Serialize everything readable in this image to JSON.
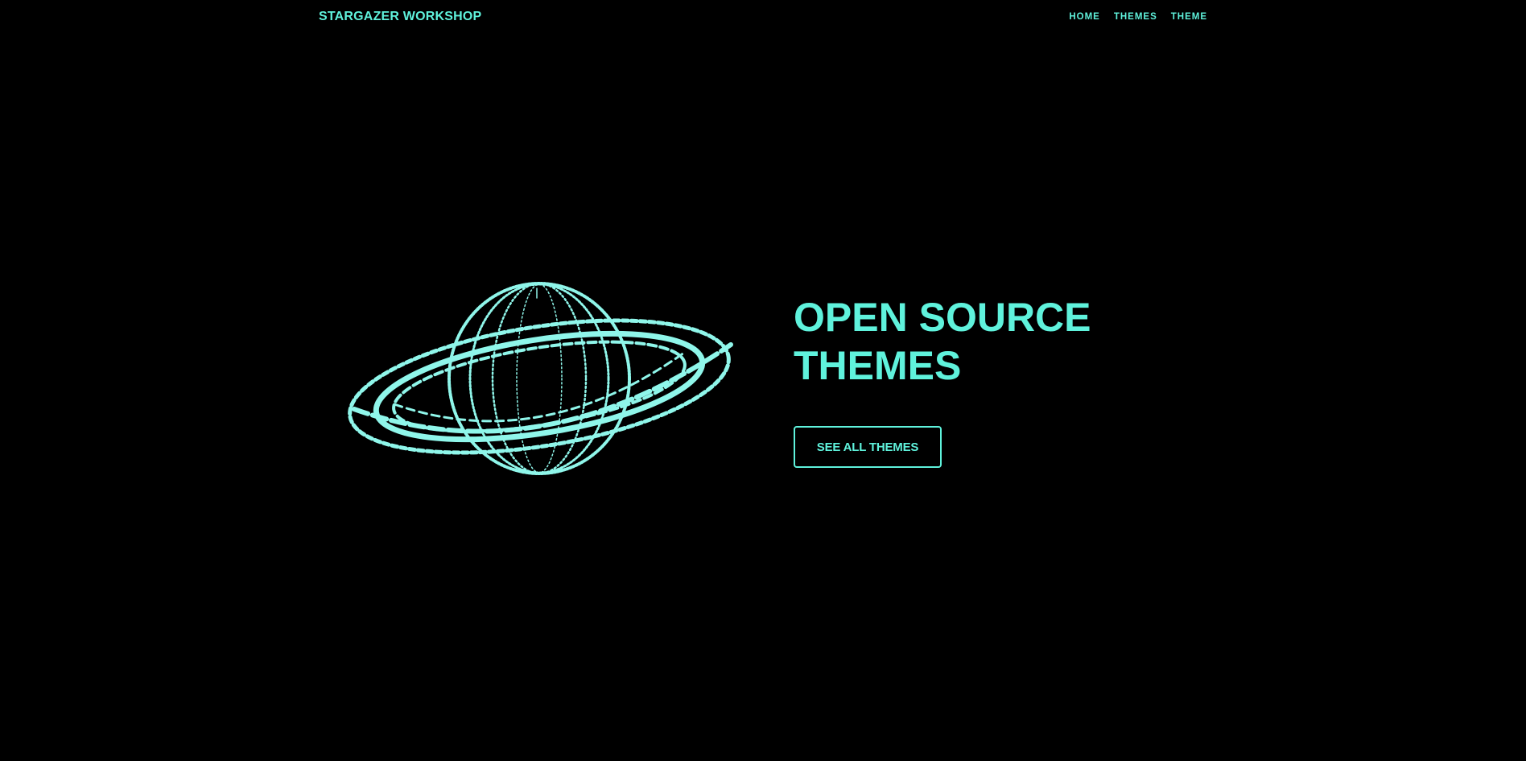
{
  "brand": {
    "name": "STARGAZER WORKSHOP",
    "color": "#5ff2dc"
  },
  "nav": {
    "items": [
      {
        "label": "HOME"
      },
      {
        "label": "THEMES"
      },
      {
        "label": "THEME"
      }
    ]
  },
  "hero": {
    "illustration_icon": "wireframe-planet-icon",
    "title_line1": "OPEN SOURCE",
    "title_line2": "THEMES",
    "cta_label": "SEE ALL THEMES"
  },
  "colors": {
    "background": "#000000",
    "accent": "#5ff2dc"
  }
}
